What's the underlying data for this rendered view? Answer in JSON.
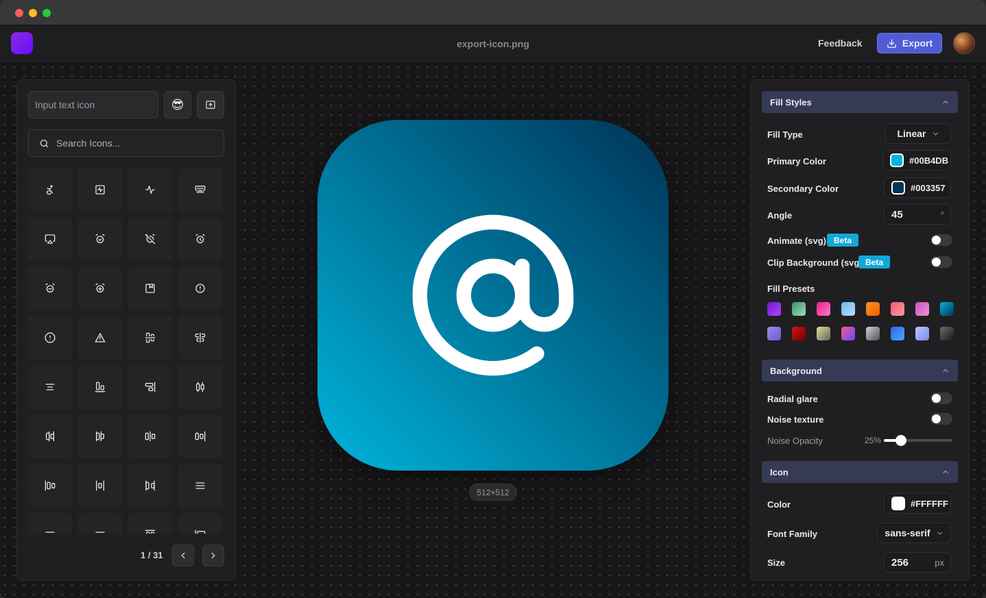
{
  "app": {
    "filename": "export-icon.png",
    "feedback_label": "Feedback",
    "export_label": "Export"
  },
  "left": {
    "text_input_placeholder": "Input text icon",
    "emoji_button_icon": "😎",
    "search_placeholder": "Search Icons...",
    "page_label": "1 / 31",
    "icons": [
      "accessibility-icon",
      "activity-square-icon",
      "activity-icon",
      "air-vent-icon",
      "airplay-icon",
      "alarm-check-icon",
      "alarm-clock-off-icon",
      "alarm-clock-icon",
      "alarm-minus-icon",
      "alarm-plus-icon",
      "album-icon",
      "alert-circle-icon",
      "alert-octagon-icon",
      "alert-triangle-icon",
      "align-center-horizontal-icon",
      "align-center-vertical-icon",
      "align-center-icon",
      "align-end-horizontal-icon",
      "align-end-vertical-icon",
      "align-horizontal-distribute-center-icon",
      "align-horizontal-distribute-end-icon",
      "align-horizontal-distribute-start-icon",
      "align-horizontal-justify-center-icon",
      "align-horizontal-justify-end-icon",
      "align-horizontal-justify-start-icon",
      "align-horizontal-space-around-icon",
      "align-horizontal-space-between-icon",
      "align-justify-icon",
      "align-left-icon",
      "align-right-icon",
      "align-start-horizontal-icon",
      "align-start-vertical-icon"
    ]
  },
  "preview": {
    "size_label": "512×512",
    "icon_name": "at-sign-icon"
  },
  "fill_styles": {
    "section_title": "Fill Styles",
    "fill_type_label": "Fill Type",
    "fill_type_value": "Linear",
    "primary_color_label": "Primary Color",
    "primary_color": "#00B4DB",
    "secondary_color_label": "Secondary Color",
    "secondary_color": "#003357",
    "angle_label": "Angle",
    "angle_value": "45",
    "angle_unit": "°",
    "animate_label": "Animate (svg)",
    "clip_label": "Clip Background (svg)",
    "beta_label": "Beta",
    "animate_on": false,
    "clip_on": false,
    "presets_label": "Fill Presets",
    "presets": [
      [
        "#7a12d4",
        "#a74bff"
      ],
      [
        "#3e8e6a",
        "#9be0b8"
      ],
      [
        "#e8208a",
        "#ff79c6"
      ],
      [
        "#6fb4e8",
        "#b8e0ff"
      ],
      [
        "#f7971e",
        "#ff5a00"
      ],
      [
        "#f05a7a",
        "#ff9a9e"
      ],
      [
        "#c353c8",
        "#f293d3"
      ],
      [
        "#00B4DB",
        "#003357"
      ],
      [
        "#9a8cf0",
        "#6a5acd"
      ],
      [
        "#e01010",
        "#6a0000"
      ],
      [
        "#e8d8a0",
        "#5a6a5a"
      ],
      [
        "#ff5a8a",
        "#5a4aff"
      ],
      [
        "#d0d0d8",
        "#505058"
      ],
      [
        "#2a6ae8",
        "#4aa8ff"
      ],
      [
        "#b8c8ff",
        "#7a8ae8"
      ],
      [
        "#6a6a6e",
        "#1a1a1c"
      ]
    ]
  },
  "background": {
    "section_title": "Background",
    "radial_glare_label": "Radial glare",
    "radial_glare_on": false,
    "noise_texture_label": "Noise texture",
    "noise_texture_on": false,
    "noise_opacity_label": "Noise Opacity",
    "noise_opacity_value": "25%",
    "noise_opacity_fraction": 0.25
  },
  "icon": {
    "section_title": "Icon",
    "color_label": "Color",
    "color_value": "#FFFFFF",
    "font_family_label": "Font Family",
    "font_family_value": "sans-serif",
    "size_label": "Size",
    "size_value": "256",
    "size_unit": "px"
  }
}
